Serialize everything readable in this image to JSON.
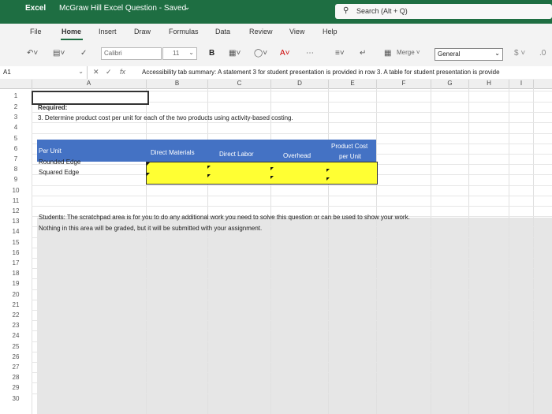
{
  "titlebar": {
    "app": "Excel",
    "document": "McGraw Hill Excel Question",
    "status": "Saved",
    "search_placeholder": "Search (Alt + Q)"
  },
  "tabs": [
    "File",
    "Home",
    "Insert",
    "Draw",
    "Formulas",
    "Data",
    "Review",
    "View",
    "Help"
  ],
  "ribbon": {
    "font_name": "Calibri",
    "font_size": "11",
    "bold": "B",
    "merge": "Merge",
    "number_format": "General",
    "currency": "$"
  },
  "formula_bar": {
    "name_box": "A1",
    "fx": "fx",
    "content": "Accessibility tab summary: A statement 3 for student presentation is provided in row 3. A table for student presentation is provide"
  },
  "columns": [
    "A",
    "B",
    "C",
    "D",
    "E",
    "F",
    "G",
    "H",
    "I"
  ],
  "rows": [
    "1",
    "2",
    "3",
    "4",
    "5",
    "6",
    "7",
    "8",
    "9",
    "10",
    "11",
    "12",
    "13",
    "14",
    "15",
    "16",
    "17",
    "18",
    "19",
    "20",
    "21",
    "22",
    "23",
    "24",
    "25",
    "26",
    "27",
    "28",
    "29",
    "30"
  ],
  "sheet": {
    "required": "Required:",
    "question": "3. Determine product cost per unit for each of the two products using activity-based costing.",
    "table_headers": {
      "per_unit": "Per Unit",
      "direct_materials": "Direct Materials",
      "direct_labor": "Direct Labor",
      "overhead": "Overhead",
      "product_cost_1": "Product Cost",
      "product_cost_2": "per Unit"
    },
    "products": [
      "Rounded Edge",
      "Squared Edge"
    ],
    "scratch_1": "Students: The scratchpad area is for you to do any additional work you need to solve this question or can be used to show your work.",
    "scratch_2": "Nothing in this area will be graded, but it will be submitted with your assignment."
  },
  "colors": {
    "title_green": "#1e6e42",
    "table_header_blue": "#4472c4",
    "input_yellow": "#ffff33",
    "scratch_gray": "#e6e6e6"
  }
}
